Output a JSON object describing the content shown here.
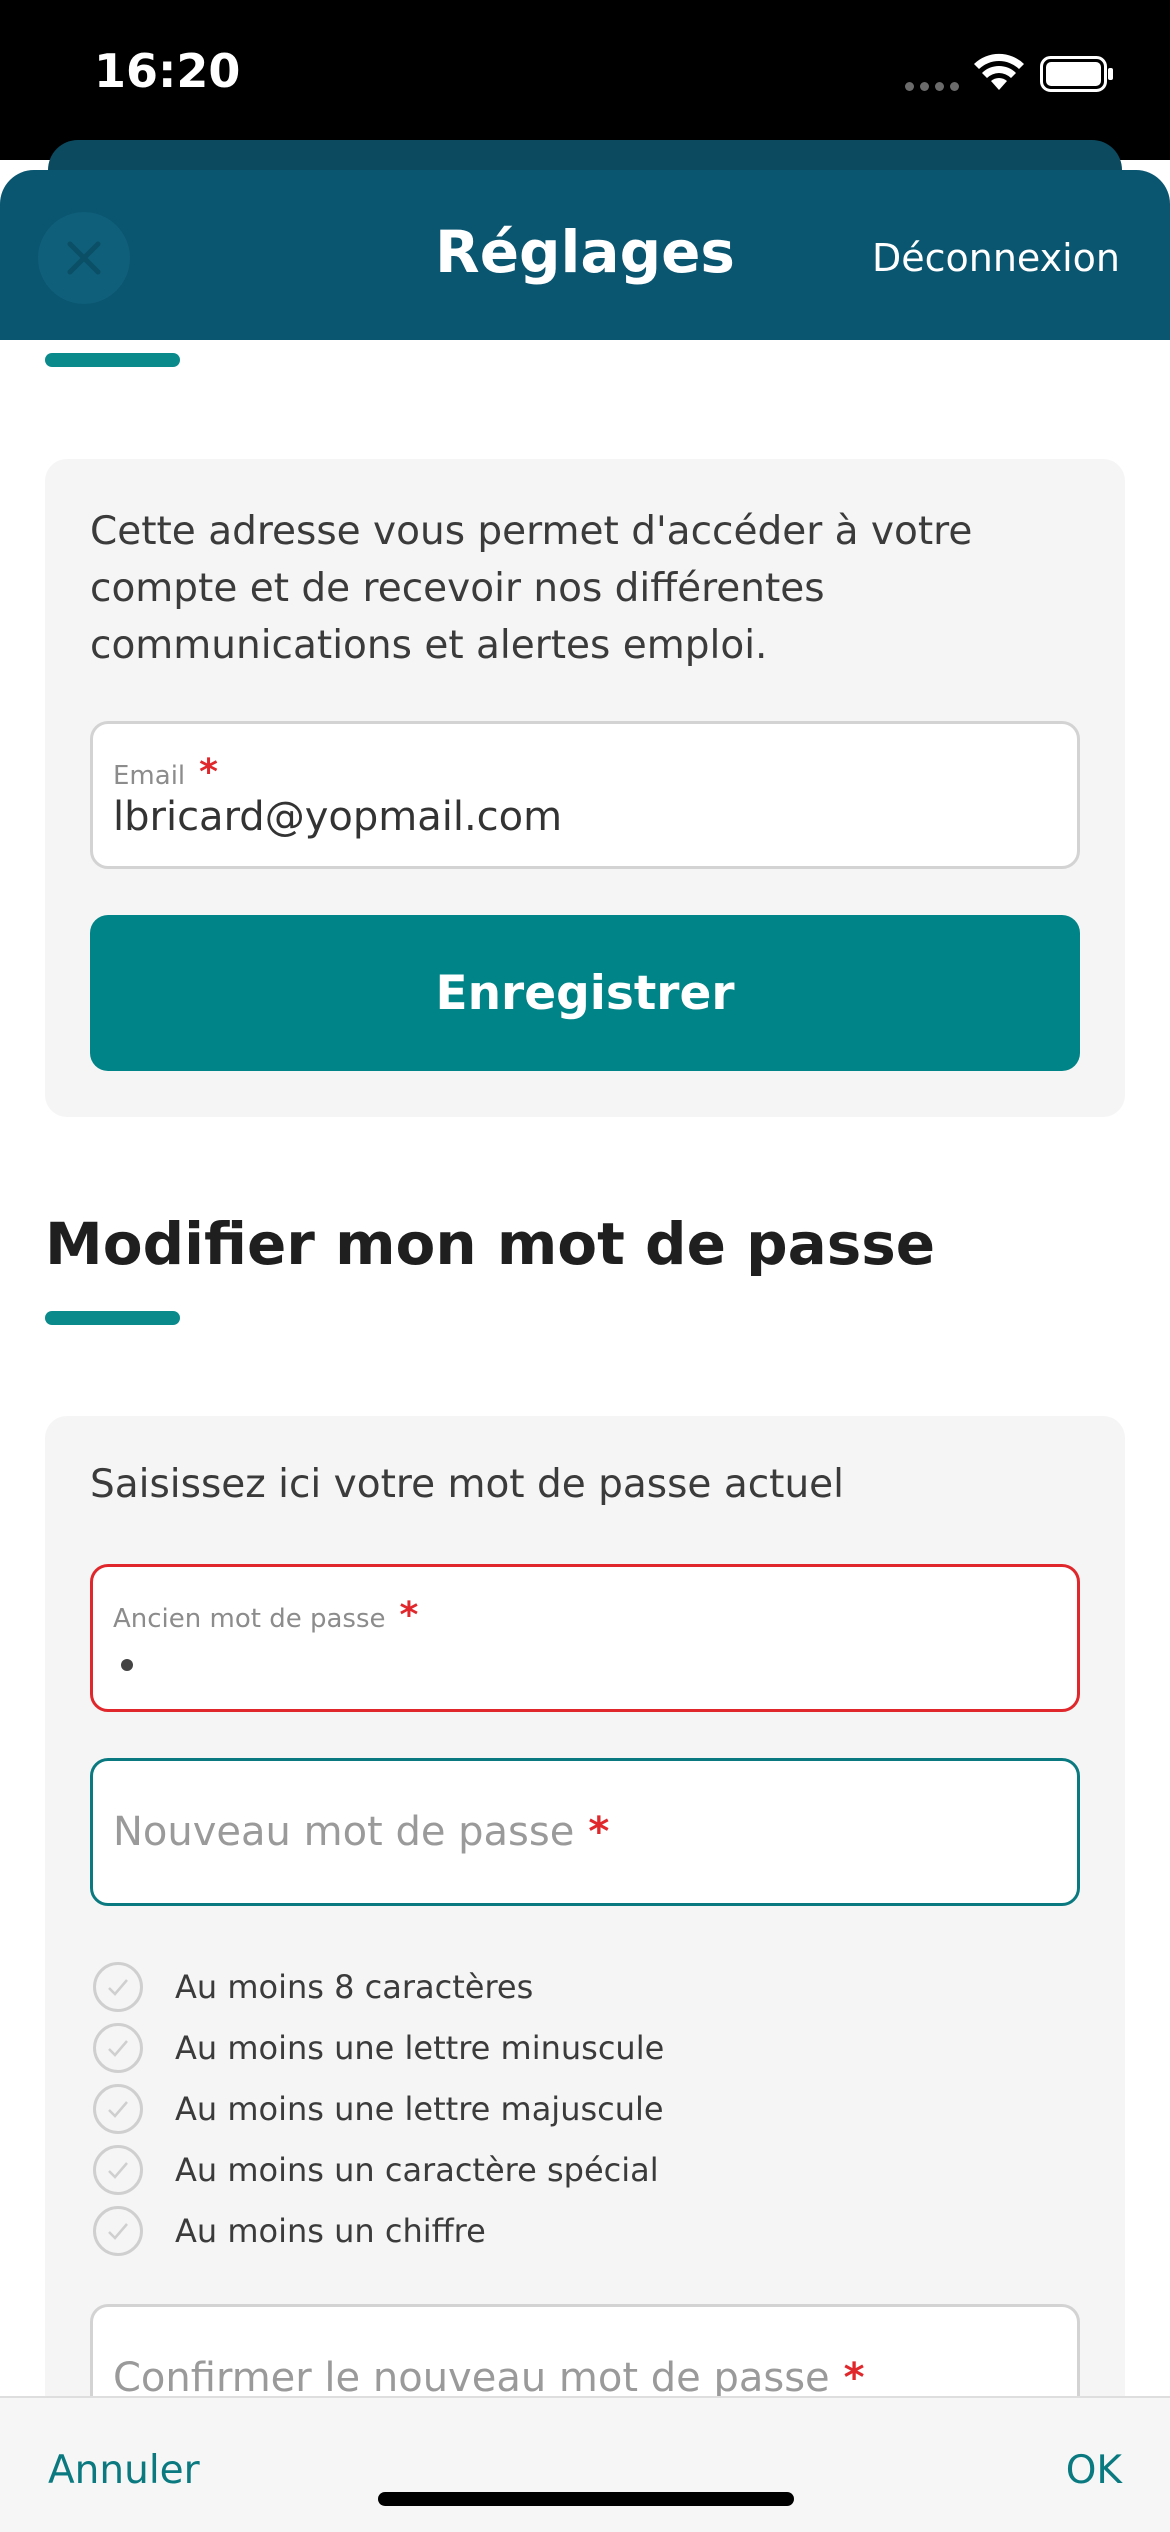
{
  "status_bar": {
    "time": "16:20"
  },
  "header": {
    "title": "Réglages",
    "logout_label": "Déconnexion"
  },
  "email_section": {
    "intro": "Cette adresse vous permet d'accéder à votre compte et de recevoir nos différentes communications et alertes emploi.",
    "email_label": "Email",
    "required_mark": "*",
    "email_value": "lbricard@yopmail.com",
    "save_label": "Enregistrer"
  },
  "password_section": {
    "title": "Modifier mon mot de passe",
    "intro": "Saisissez ici votre mot de passe actuel",
    "old_label": "Ancien mot de passe",
    "required_mark": "*",
    "new_placeholder": "Nouveau mot de passe",
    "confirm_placeholder": "Confirmer le nouveau mot de passe",
    "rules": [
      "Au moins 8 caractères",
      "Au moins une lettre minuscule",
      "Au moins une lettre majuscule",
      "Au moins un caractère spécial",
      "Au moins un chiffre"
    ]
  },
  "bottom_bar": {
    "cancel_label": "Annuler",
    "ok_label": "OK"
  },
  "colors": {
    "header": "#0a5570",
    "accent": "#008487",
    "error": "#e0272b"
  },
  "icons": [
    "close-icon",
    "wifi-icon",
    "battery-icon",
    "check-icon"
  ]
}
